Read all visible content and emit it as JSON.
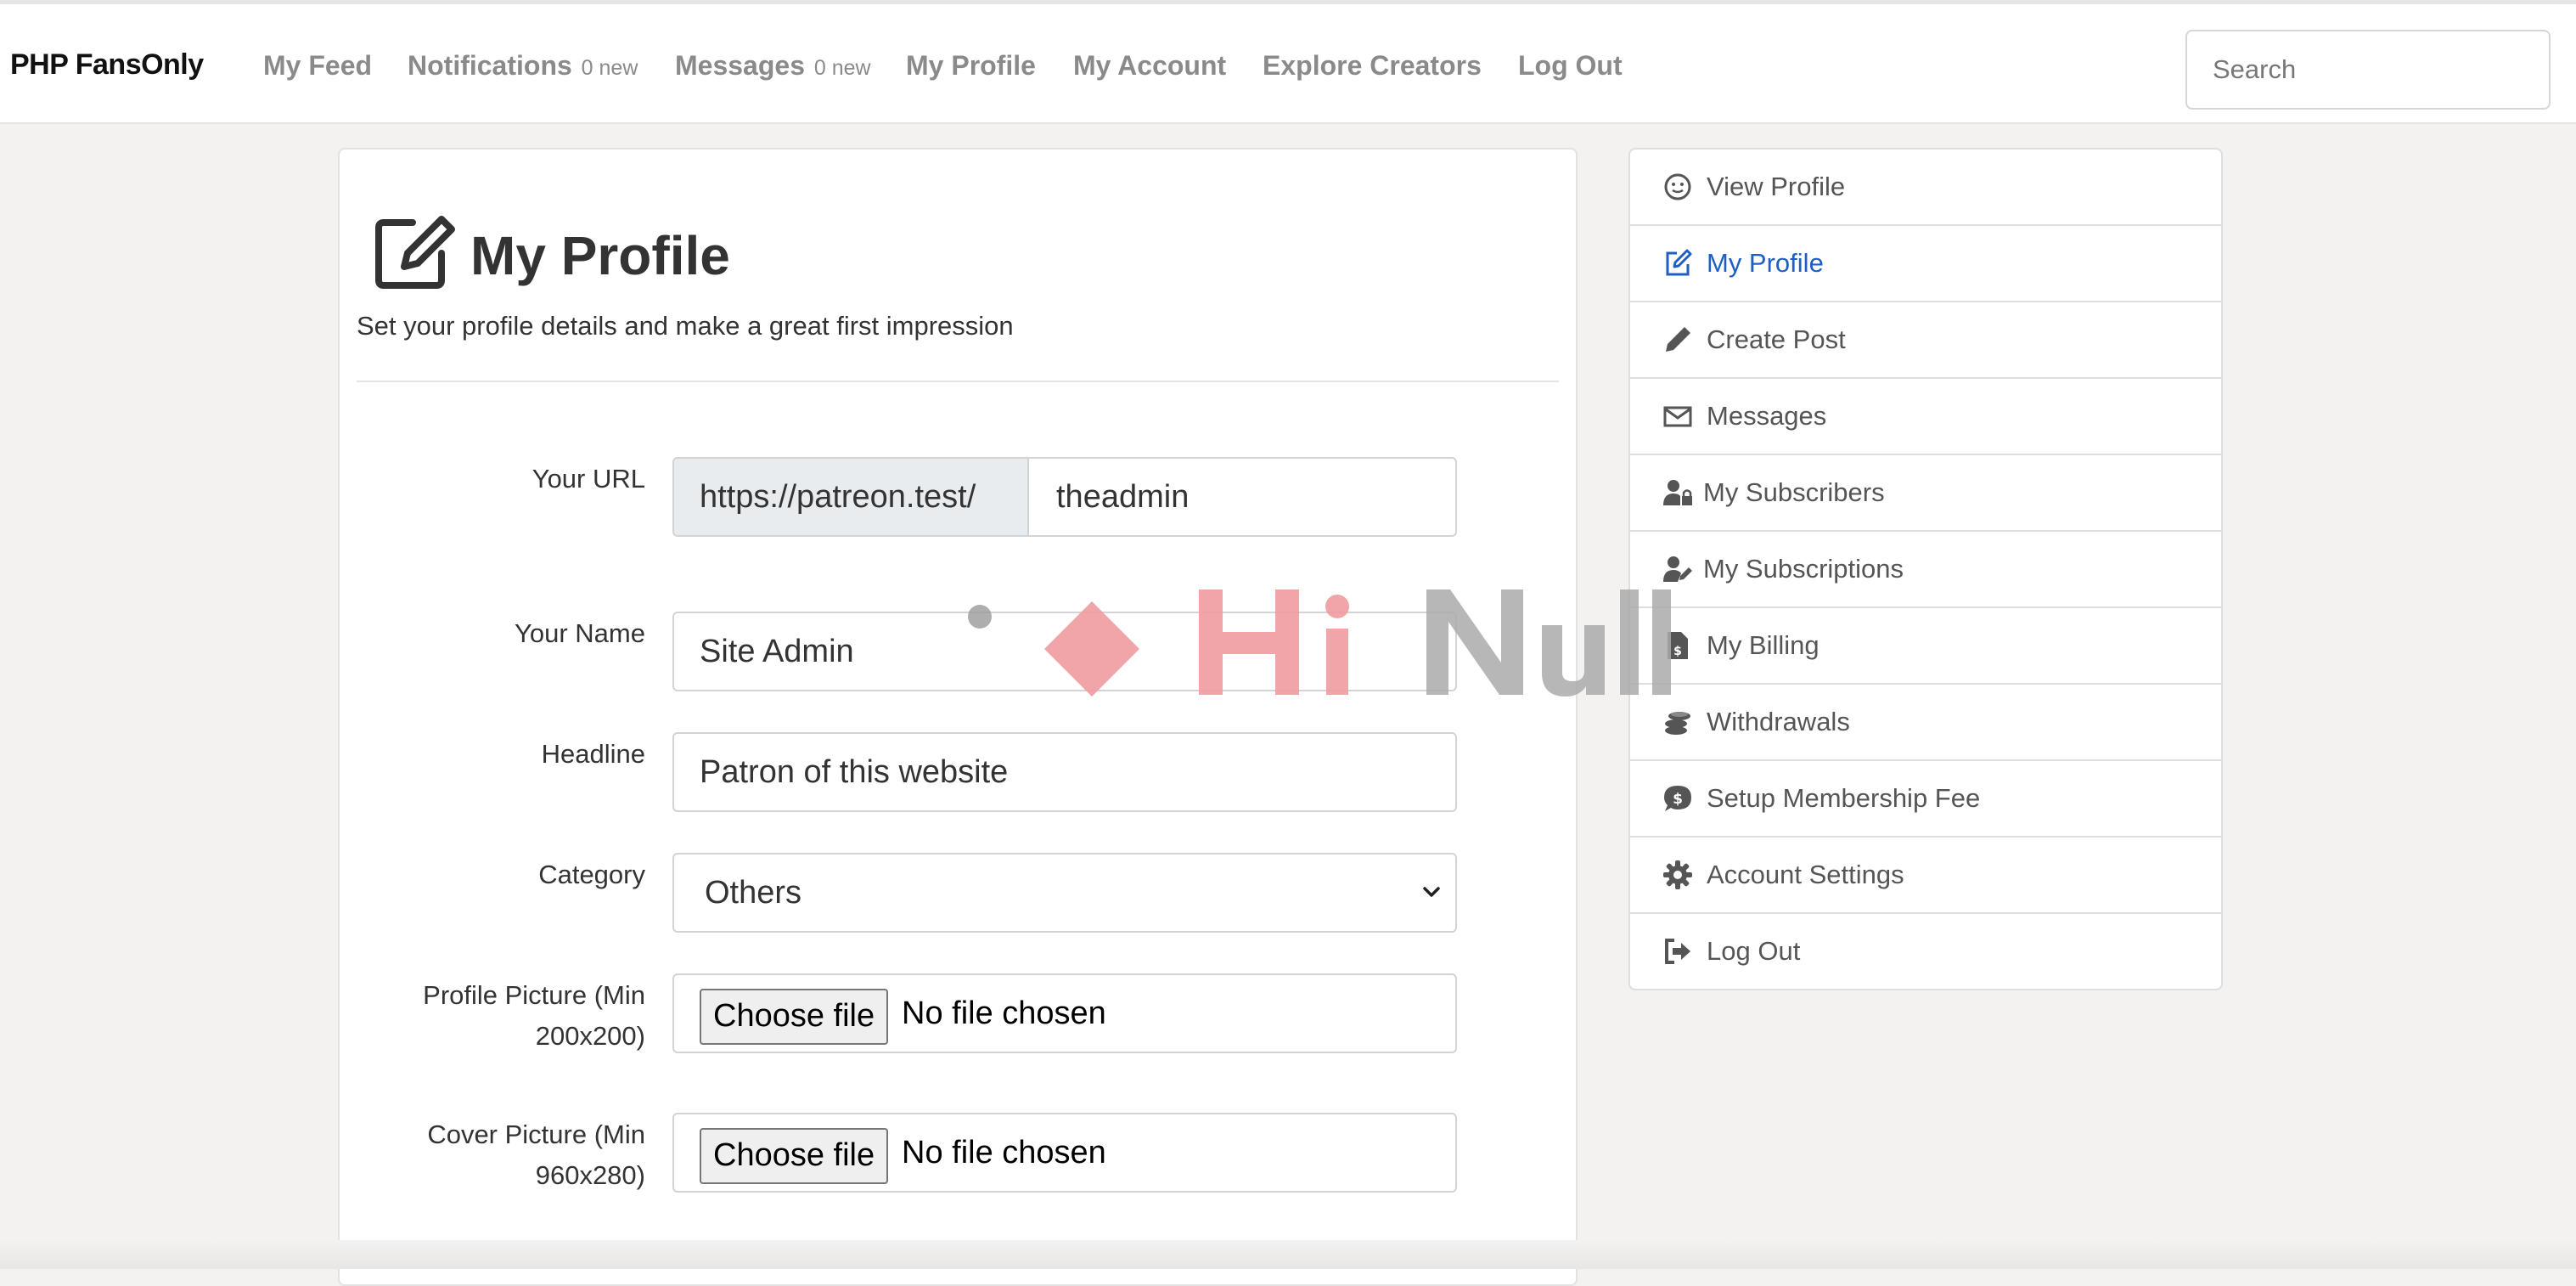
{
  "navbar": {
    "brand": "PHP FansOnly",
    "items": [
      {
        "label": "My Feed"
      },
      {
        "label": "Notifications",
        "count": "0 new"
      },
      {
        "label": "Messages",
        "count": "0 new"
      },
      {
        "label": "My Profile"
      },
      {
        "label": "My Account"
      },
      {
        "label": "Explore Creators"
      },
      {
        "label": "Log Out"
      }
    ],
    "search_placeholder": "Search"
  },
  "page": {
    "title": "My Profile",
    "subtitle": "Set your profile details and make a great first impression",
    "title_icon": "edit-square-icon"
  },
  "form": {
    "url_label": "Your URL",
    "url_prefix": "https://patreon.test/",
    "url_value": "theadmin",
    "name_label": "Your Name",
    "name_value": "Site Admin",
    "headline_label": "Headline",
    "headline_value": "Patron of this website",
    "category_label": "Category",
    "category_value": "Others",
    "profile_pic_label_1": "Profile Picture (Min",
    "profile_pic_label_2": "200x200)",
    "cover_pic_label_1": "Cover Picture (Min",
    "cover_pic_label_2": "960x280)",
    "choose_file": "Choose file",
    "no_file": "No file chosen"
  },
  "sidebar": {
    "items": [
      {
        "label": "View Profile",
        "icon": "smiley-icon"
      },
      {
        "label": "My Profile",
        "icon": "edit-square-icon",
        "active": true
      },
      {
        "label": "Create Post",
        "icon": "pencil-icon"
      },
      {
        "label": "Messages",
        "icon": "envelope-icon"
      },
      {
        "label": "My Subscribers",
        "icon": "user-lock-icon"
      },
      {
        "label": "My Subscriptions",
        "icon": "user-edit-icon"
      },
      {
        "label": "My Billing",
        "icon": "invoice-dollar-icon"
      },
      {
        "label": "Withdrawals",
        "icon": "coins-icon"
      },
      {
        "label": "Setup Membership Fee",
        "icon": "dollar-chat-icon"
      },
      {
        "label": "Account Settings",
        "icon": "gear-icon"
      },
      {
        "label": "Log Out",
        "icon": "sign-out-icon"
      }
    ]
  },
  "colors": {
    "active_link": "#1d5fc2",
    "nav_text": "#8a8a8a",
    "background": "#f3f2f1"
  }
}
